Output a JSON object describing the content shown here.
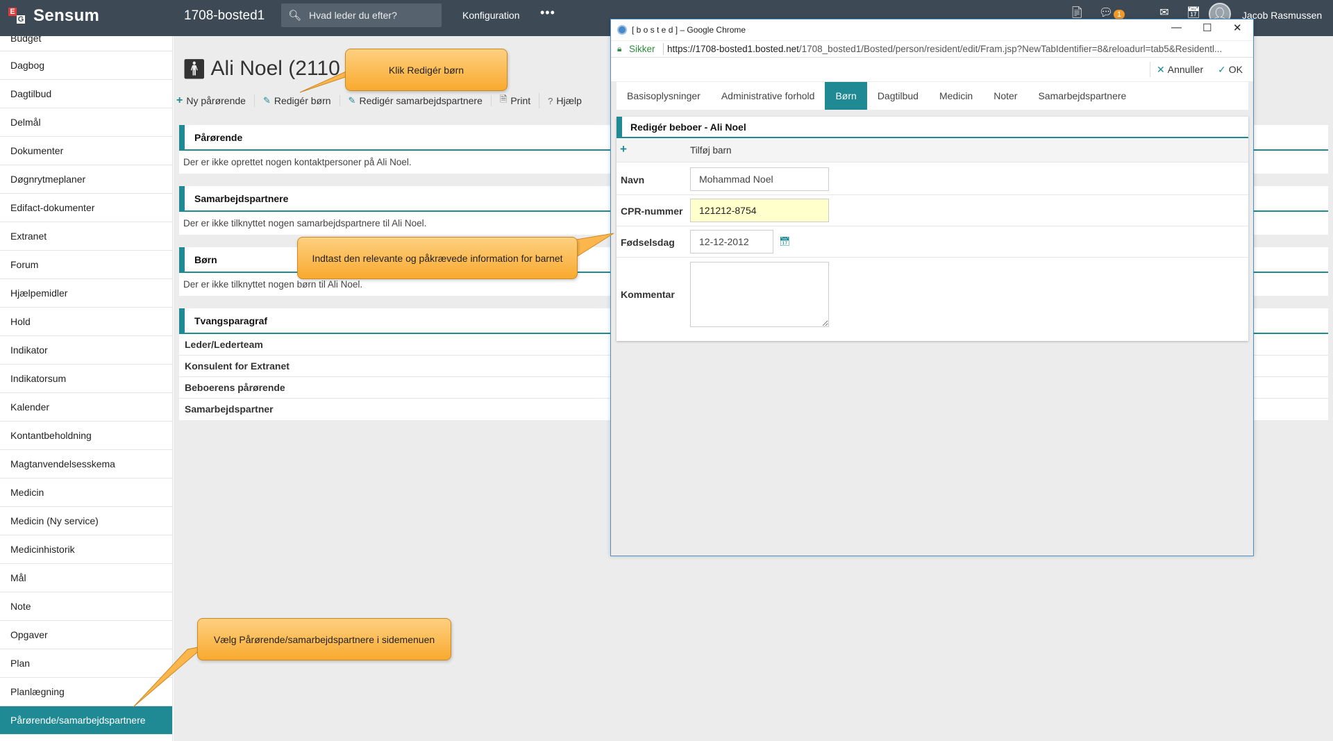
{
  "topbar": {
    "logo_e": "E",
    "logo_g": "G",
    "logo_text": "Sensum",
    "site_name": "1708-bosted1",
    "search_placeholder": "Hvad leder du efter?",
    "config_label": "Konfiguration",
    "more_label": "•••",
    "badge_count": "1",
    "username": "Jacob Rasmussen"
  },
  "sidebar": {
    "items": [
      "Budget",
      "Dagbog",
      "Dagtilbud",
      "Delmål",
      "Dokumenter",
      "Døgnrytmeplaner",
      "Edifact-dokumenter",
      "Extranet",
      "Forum",
      "Hjælpemidler",
      "Hold",
      "Indikator",
      "Indikatorsum",
      "Kalender",
      "Kontantbeholdning",
      "Magtanvendelsesskema",
      "Medicin",
      "Medicin (Ny service)",
      "Medicinhistorik",
      "Mål",
      "Note",
      "Opgaver",
      "Plan",
      "Planlægning",
      "Pårørende/samarbejdspartnere"
    ],
    "active_index": 24
  },
  "main": {
    "person_title": "Ali Noel (2110",
    "actions": [
      "Ny pårørende",
      "Redigér børn",
      "Redigér samarbejdspartnere",
      "Print",
      "Hjælp"
    ],
    "panels": {
      "parorende_title": "Pårørende",
      "parorende_text": "Der er ikke oprettet nogen kontaktpersoner på Ali Noel.",
      "samarbejd_title": "Samarbejdspartnere",
      "samarbejd_text": "Der er ikke tilknyttet nogen samarbejdspartnere til Ali Noel.",
      "born_title": "Børn",
      "born_text": "Der er ikke tilknyttet nogen børn til Ali Noel.",
      "tvang_title": "Tvangsparagraf",
      "tvang_rows": [
        "Leder/Lederteam",
        "Konsulent for Extranet",
        "Beboerens pårørende",
        "Samarbejdspartner"
      ]
    }
  },
  "popup": {
    "window_title": "[ b o s t e d ] – Google Chrome",
    "secure_label": "Sikker",
    "url_host": "https://1708-bosted1.bosted.net",
    "url_path": "/1708_bosted1/Bosted/person/resident/edit/Fram.jsp?NewTabIdentifier=8&reloadurl=tab5&Residentl...",
    "cancel_label": "Annuller",
    "ok_label": "OK",
    "tabs": [
      "Basisoplysninger",
      "Administrative forhold",
      "Børn",
      "Dagtilbud",
      "Medicin",
      "Noter",
      "Samarbejdspartnere"
    ],
    "active_tab": "Børn",
    "form": {
      "title": "Redigér beboer - Ali Noel",
      "add_child_label": "Tilføj barn",
      "name_label": "Navn",
      "name_value": "Mohammad Noel",
      "cpr_label": "CPR-nummer",
      "cpr_value": "121212-8754",
      "birthday_label": "Fødselsdag",
      "birthday_value": "12-12-2012",
      "comment_label": "Kommentar",
      "comment_value": ""
    }
  },
  "callouts": {
    "edit_children": "Klik Redigér børn",
    "enter_info": "Indtast den relevante og påkrævede information for barnet",
    "choose_menu": "Vælg Pårørende/samarbejdspartnere i sidemenuen"
  },
  "colors": {
    "topbar": "#3d4a56",
    "accent": "#1f8a94",
    "callout": "#fdb64c",
    "highlight_field": "#ffffcc"
  }
}
